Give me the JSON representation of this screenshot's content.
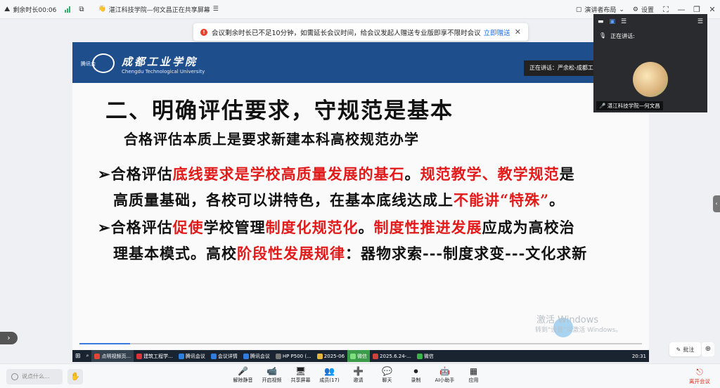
{
  "topbar": {
    "timer": "剩余时长00:06",
    "share_title": "湛江科技学院—何文昌正在共享屏幕",
    "presenter_layout": "演讲者布局",
    "settings": "设置"
  },
  "notice": {
    "text": "会议剩余时长已不足10分钟，如需延长会议时间，给会议发起人赠送专业版即享不限时会议",
    "link": "立即赠送"
  },
  "slide": {
    "logo_tag": "腾讯会",
    "uni_cn": "成都工业学院",
    "uni_en": "Chengdu Technological University",
    "speaking": "正在讲话：严余松-成都工业",
    "title": "二、明确评估要求，守规范是基本",
    "subtitle": "合格评估本质上是要求新建本科高校规范办学",
    "p1_a": "➢合格评估",
    "p1_b": "底线要求是学校高质量发展的基石",
    "p1_c": "。",
    "p1_d": "规范教学、教学规范",
    "p1_e": "是",
    "p1_line2_a": "高质量基础，各校可以讲特色，在基本底线达成上",
    "p1_line2_b": "不能讲“特殊”",
    "p1_line2_c": "。",
    "p2_a": "➢合格评估",
    "p2_b": "促使",
    "p2_c": "学校管理",
    "p2_d": "制度化规范化",
    "p2_e": "。",
    "p2_f": "制度性推进发展",
    "p2_g": "应成为高校治",
    "p2_line2_a": "理基本模式。高校",
    "p2_line2_b": "阶段性发展规律",
    "p2_line2_c": "：器物求索---制度求变---文化求新",
    "watermark": "激活 Windows",
    "watermark2": "转到\"设置\"以激活 Windows。"
  },
  "taskbar": [
    "点明视频页...",
    "建筑工程学...",
    "腾讯会议",
    "会议详情",
    "腾讯会议",
    "HP P500 (...",
    "2025-06",
    "微信",
    "2025.6.24-...",
    "微信"
  ],
  "taskbar_time": "20:31",
  "video": {
    "speaking_label": "正在讲话:",
    "name": "湛江科技学院—何文昌"
  },
  "annot": "批注",
  "bottom": {
    "chat_placeholder": "说点什么...",
    "tools": [
      {
        "icon": "🎤",
        "label": "解除静音"
      },
      {
        "icon": "📹",
        "label": "开启视频"
      },
      {
        "icon": "🖥",
        "label": "共享屏幕"
      },
      {
        "icon": "👥",
        "label": "成员(17)"
      },
      {
        "icon": "➕",
        "label": "邀请"
      },
      {
        "icon": "💬",
        "label": "聊天"
      },
      {
        "icon": "⏺",
        "label": "录制"
      },
      {
        "icon": "🤖",
        "label": "AI小助手"
      },
      {
        "icon": "▦",
        "label": "应用"
      }
    ],
    "leave": "离开会议"
  }
}
